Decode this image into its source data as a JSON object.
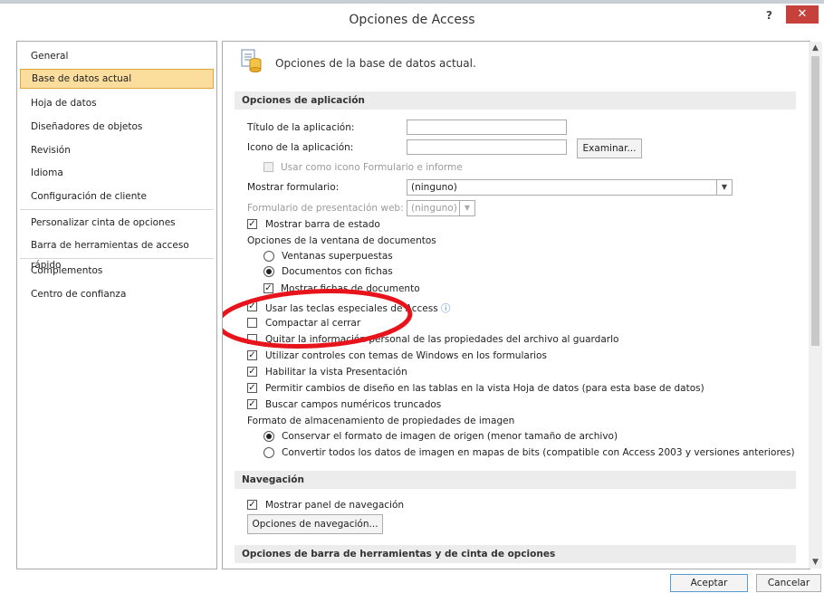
{
  "window": {
    "title": "Opciones de Access",
    "help": "?",
    "close": "✕"
  },
  "nav": {
    "items": [
      {
        "label": "General"
      },
      {
        "label": "Base de datos actual"
      },
      {
        "label": "Hoja de datos"
      },
      {
        "label": "Diseñadores de objetos"
      },
      {
        "label": "Revisión"
      },
      {
        "label": "Idioma"
      },
      {
        "label": "Configuración de cliente"
      },
      {
        "label": "Personalizar cinta de opciones"
      },
      {
        "label": "Barra de herramientas de acceso rápido"
      },
      {
        "label": "Complementos"
      },
      {
        "label": "Centro de confianza"
      }
    ],
    "selected": "Base de datos actual"
  },
  "header": {
    "title": "Opciones de la base de datos actual.",
    "icon": "database-options-icon"
  },
  "app_options": {
    "section_title": "Opciones de aplicación",
    "app_title_label": "Título de la aplicación:",
    "app_title_value": "",
    "app_icon_label": "Icono de la aplicación:",
    "app_icon_value": "",
    "browse_label": "Examinar...",
    "use_as_icon_label": "Usar como icono Formulario e informe",
    "show_form_label": "Mostrar formulario:",
    "show_form_value": "(ninguno)",
    "web_form_label": "Formulario de presentación web:",
    "web_form_value": "(ninguno)",
    "status_bar_label": "Mostrar barra de estado",
    "doc_window_label": "Opciones de la ventana de documentos",
    "overlap_label": "Ventanas superpuestas",
    "tabbed_label": "Documentos con fichas",
    "show_tabs_label": "Mostrar fichas de documento",
    "special_keys_label": "Usar las teclas especiales de Access",
    "info_icon": "ⓘ",
    "compact_label": "Compactar al cerrar",
    "remove_personal_label": "Quitar la información personal de las propiedades del archivo al guardarlo",
    "windows_theme_label": "Utilizar controles con temas de Windows en los formularios",
    "layout_view_label": "Habilitar la vista Presentación",
    "design_changes_label": "Permitir cambios de diseño en las tablas en la vista Hoja de datos (para esta base de datos)",
    "truncated_label": "Buscar campos numéricos truncados",
    "image_format_label": "Formato de almacenamiento de propiedades de imagen",
    "keep_source_label": "Conservar el formato de imagen de origen (menor tamaño de archivo)",
    "convert_bitmap_label": "Convertir todos los datos de imagen en mapas de bits (compatible con Access 2003 y versiones anteriores)",
    "status_bar": true,
    "tabbed_documents": true,
    "show_document_tabs": true,
    "special_keys": true,
    "compact_on_close": false,
    "remove_personal_info": false,
    "windows_theme_controls": true,
    "layout_view": true,
    "design_changes": true,
    "truncated_fields": true,
    "keep_source_format": true
  },
  "navigation": {
    "section_title": "Navegación",
    "show_pane_label": "Mostrar panel de navegación",
    "show_pane": true,
    "options_button": "Opciones de navegación..."
  },
  "toolbar_section": {
    "section_title": "Opciones de barra de herramientas y de cinta de opciones"
  },
  "footer": {
    "ok": "Aceptar",
    "cancel": "Cancelar"
  },
  "annotation": {
    "color": "#e8141b"
  }
}
